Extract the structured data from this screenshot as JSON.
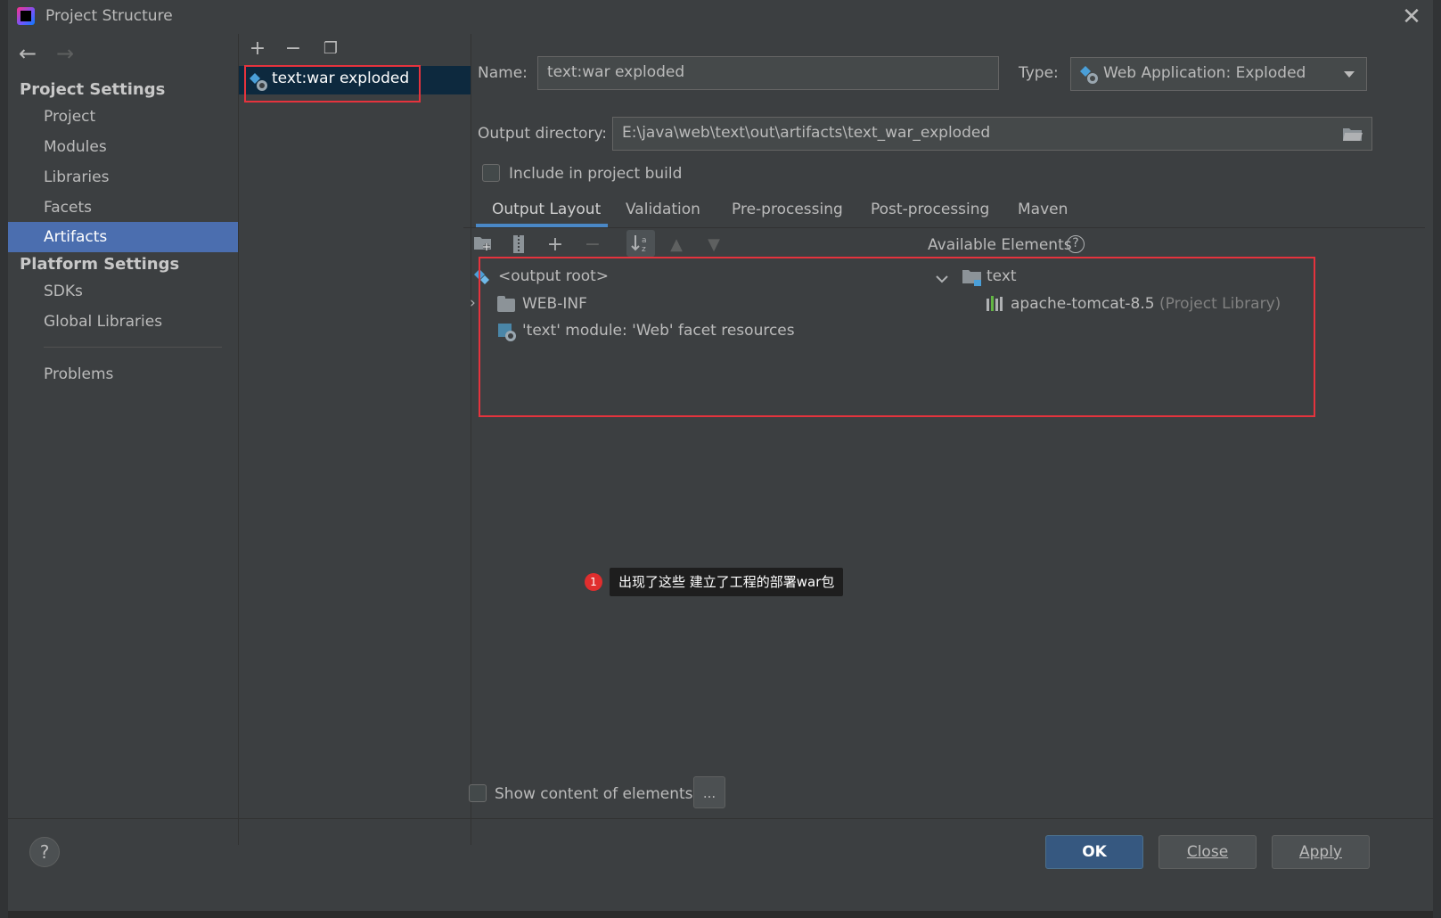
{
  "window": {
    "title": "Project Structure"
  },
  "sidebar": {
    "project_settings_header": "Project Settings",
    "project_items": [
      "Project",
      "Modules",
      "Libraries",
      "Facets",
      "Artifacts"
    ],
    "platform_settings_header": "Platform Settings",
    "platform_items": [
      "SDKs",
      "Global Libraries"
    ],
    "problems": "Problems",
    "selected": "Artifacts"
  },
  "artifacts_list": {
    "items": [
      "text:war exploded"
    ]
  },
  "form": {
    "name_label": "Name:",
    "name_value": "text:war exploded",
    "type_label": "Type:",
    "type_value": "Web Application: Exploded",
    "output_dir_label": "Output directory:",
    "output_dir_value": "E:\\java\\web\\text\\out\\artifacts\\text_war_exploded",
    "include_build_label": "Include in project build",
    "include_build_checked": false
  },
  "tabs": {
    "items": [
      "Output Layout",
      "Validation",
      "Pre-processing",
      "Post-processing",
      "Maven"
    ],
    "active": "Output Layout"
  },
  "layout_tree": {
    "root": "<output root>",
    "web_inf": "WEB-INF",
    "facet_resources": "'text' module: 'Web' facet resources"
  },
  "available_elements": {
    "header": "Available Elements",
    "module": "text",
    "library_name": "apache-tomcat-8.5",
    "library_hint": "(Project Library)"
  },
  "annotation": {
    "badge": "1",
    "text": "出现了这些  建立了工程的部署war包"
  },
  "show_content_label": "Show content of elements",
  "show_content_checked": false,
  "ellipsis_button": "...",
  "buttons": {
    "ok": "OK",
    "close": "Close",
    "apply": "Apply",
    "help": "?"
  },
  "colors": {
    "selection": "#4b6eaf",
    "highlight_box": "#e5333d",
    "primary_button": "#365880",
    "tab_underline": "#4a88c7"
  }
}
